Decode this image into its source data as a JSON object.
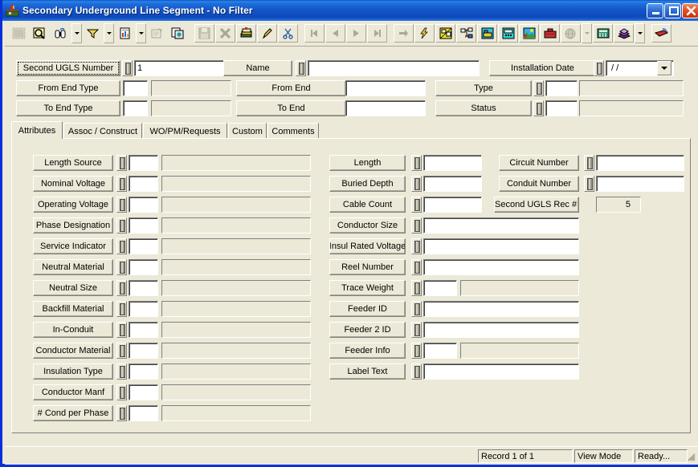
{
  "window": {
    "title": "Secondary Underground Line Segment - No Filter",
    "icon": "application-icon",
    "minimize_label": "_",
    "maximize_label": "□",
    "close_label": "✕",
    "accent_title_color": "#1456c8",
    "face_color": "#ece9d8",
    "frame_color": "#0831d9"
  },
  "toolbar": {
    "items": [
      {
        "name": "grid-view-icon",
        "title": "Grid View",
        "enabled": false
      },
      {
        "name": "find-icon",
        "title": "Find",
        "enabled": true
      },
      {
        "name": "binoculars-search-icon",
        "title": "Search",
        "enabled": true
      },
      {
        "name": "search-dropdown-arrow",
        "title": "Search Options",
        "enabled": true
      },
      {
        "name": "filter-funnel-icon",
        "title": "Filter",
        "enabled": true
      },
      {
        "name": "filter-dropdown-arrow",
        "title": "Filter Options",
        "enabled": true
      },
      {
        "name": "report-icon",
        "title": "Report",
        "enabled": true
      },
      {
        "name": "report-dropdown-arrow",
        "title": "Report Options",
        "enabled": true
      },
      {
        "name": "properties-icon",
        "title": "Properties",
        "enabled": false
      },
      {
        "name": "copy-record-icon",
        "title": "Copy Record",
        "enabled": true
      },
      {
        "name": "save-icon",
        "title": "Save",
        "enabled": false
      },
      {
        "name": "delete-icon",
        "title": "Delete",
        "enabled": false
      },
      {
        "name": "paste-icon",
        "title": "Paste",
        "enabled": true
      },
      {
        "name": "edit-pencil-icon",
        "title": "Edit",
        "enabled": true
      },
      {
        "name": "cut-scissors-icon",
        "title": "Cut",
        "enabled": true
      },
      {
        "name": "first-record-icon",
        "title": "First Record",
        "enabled": false
      },
      {
        "name": "previous-record-icon",
        "title": "Previous Record",
        "enabled": false
      },
      {
        "name": "next-record-icon",
        "title": "Next Record",
        "enabled": false
      },
      {
        "name": "last-record-icon",
        "title": "Last Record",
        "enabled": false
      },
      {
        "name": "goto-arrow-icon",
        "title": "Go To",
        "enabled": false
      },
      {
        "name": "lightning-icon",
        "title": "Trace",
        "enabled": true
      },
      {
        "name": "map-diagram-icon",
        "title": "Map",
        "enabled": true
      },
      {
        "name": "schematic-tree-icon",
        "title": "Schematic",
        "enabled": true
      },
      {
        "name": "workstation-icon",
        "title": "Workstation",
        "enabled": true
      },
      {
        "name": "phone-icon",
        "title": "Phone",
        "enabled": true
      },
      {
        "name": "picture-icon",
        "title": "Picture",
        "enabled": true
      },
      {
        "name": "toolbox-icon",
        "title": "Toolbox",
        "enabled": true
      },
      {
        "name": "globe-icon",
        "title": "Globe",
        "enabled": false
      },
      {
        "name": "globe-dropdown-arrow",
        "title": "Globe Options",
        "enabled": false
      },
      {
        "name": "calculator-icon",
        "title": "Calculator",
        "enabled": true
      },
      {
        "name": "books-icon",
        "title": "Library",
        "enabled": true
      },
      {
        "name": "books-dropdown-arrow",
        "title": "Library Options",
        "enabled": true
      },
      {
        "name": "exit-icon",
        "title": "Exit",
        "enabled": true
      }
    ]
  },
  "header": {
    "rows": [
      {
        "left": {
          "label": "Second UGLS Number",
          "value": "1",
          "focused": true
        },
        "right": {
          "label": "Name",
          "value": ""
        },
        "far": {
          "label": "Installation Date",
          "value": "/  /"
        }
      },
      {
        "left": {
          "label": "From End Type",
          "code": "",
          "desc": ""
        },
        "right": {
          "label": "From End",
          "value": ""
        },
        "far": {
          "label": "Type",
          "code": "",
          "desc": ""
        }
      },
      {
        "left": {
          "label": "To End Type",
          "code": "",
          "desc": ""
        },
        "right": {
          "label": "To End",
          "value": ""
        },
        "far": {
          "label": "Status",
          "code": "",
          "desc": ""
        }
      }
    ]
  },
  "tabs": {
    "items": [
      {
        "label": "Attributes",
        "selected": true
      },
      {
        "label": "Assoc / Construct",
        "selected": false
      },
      {
        "label": "WO/PM/Requests",
        "selected": false
      },
      {
        "label": "Custom",
        "selected": false
      },
      {
        "label": "Comments",
        "selected": false
      }
    ]
  },
  "attributes": {
    "left_column": [
      {
        "label": "Length Source",
        "code": "",
        "desc": ""
      },
      {
        "label": "Nominal Voltage",
        "code": "",
        "desc": ""
      },
      {
        "label": "Operating Voltage",
        "code": "",
        "desc": ""
      },
      {
        "label": "Phase Designation",
        "code": "",
        "desc": ""
      },
      {
        "label": "Service Indicator",
        "code": "",
        "desc": ""
      },
      {
        "label": "Neutral Material",
        "code": "",
        "desc": ""
      },
      {
        "label": "Neutral Size",
        "code": "",
        "desc": ""
      },
      {
        "label": "Backfill Material",
        "code": "",
        "desc": ""
      },
      {
        "label": "In-Conduit",
        "code": "",
        "desc": ""
      },
      {
        "label": "Conductor Material",
        "code": "",
        "desc": ""
      },
      {
        "label": "Insulation Type",
        "code": "",
        "desc": ""
      },
      {
        "label": "Conductor Manf",
        "code": "",
        "desc": ""
      },
      {
        "label": "# Cond per Phase",
        "code": "",
        "desc": ""
      }
    ],
    "middle_column": [
      {
        "label": "Length",
        "value": "",
        "style": "short"
      },
      {
        "label": "Buried Depth",
        "value": "",
        "style": "short"
      },
      {
        "label": "Cable Count",
        "value": "",
        "style": "short"
      },
      {
        "label": "Conductor Size",
        "value": "",
        "style": "wide"
      },
      {
        "label": "Insul Rated Voltage",
        "value": "",
        "style": "wide"
      },
      {
        "label": "Reel Number",
        "value": "",
        "style": "wide"
      },
      {
        "label": "Trace Weight",
        "value": "",
        "desc": "",
        "style": "split"
      },
      {
        "label": "Feeder ID",
        "value": "",
        "style": "wide"
      },
      {
        "label": "Feeder 2 ID",
        "value": "",
        "style": "wide"
      },
      {
        "label": "Feeder Info",
        "value": "",
        "desc": "",
        "style": "split"
      },
      {
        "label": "Label Text",
        "value": "",
        "style": "wide"
      }
    ],
    "right_column": [
      {
        "label": "Circuit Number",
        "value": "",
        "type": "pick"
      },
      {
        "label": "Conduit Number",
        "value": "",
        "type": "pick"
      },
      {
        "label": "Second UGLS Rec #",
        "value": "5",
        "type": "readonly"
      }
    ]
  },
  "statusbar": {
    "record": "Record 1 of 1",
    "mode": "View Mode",
    "state": "Ready..."
  }
}
